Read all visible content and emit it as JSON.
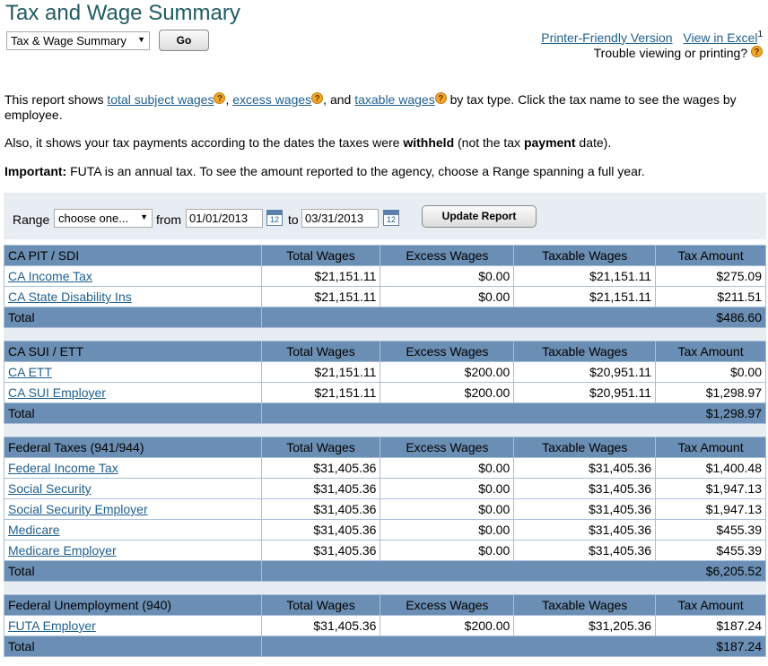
{
  "page": {
    "title": "Tax and Wage Summary",
    "report_select": "Tax & Wage Summary",
    "go_label": "Go",
    "printer_link": "Printer-Friendly Version",
    "excel_link": "View in Excel",
    "superscript": "1",
    "trouble_text": "Trouble viewing or printing?"
  },
  "intro": {
    "p1_a": "This report shows ",
    "link_total": "total subject wages",
    "sep1": ", ",
    "link_excess": "excess wages",
    "sep2": ", and ",
    "link_taxable": "taxable wages",
    "p1_b": " by tax type. Click the tax name to see the wages by employee.",
    "p2_a": "Also, it shows your tax payments according to the dates the taxes were ",
    "p2_bold1": "withheld",
    "p2_b": " (not the tax ",
    "p2_bold2": "payment",
    "p2_c": " date).",
    "p3_bold": "Important:",
    "p3_rest": " FUTA is an annual tax. To see the amount reported to the agency, choose a Range spanning a full year."
  },
  "range": {
    "label": "Range",
    "select": "choose one...",
    "from_label": "from",
    "from": "01/01/2013",
    "to_label": "to",
    "to": "03/31/2013",
    "cal_label": "12",
    "update_label": "Update Report"
  },
  "columns": [
    "Total Wages",
    "Excess Wages",
    "Taxable Wages",
    "Tax Amount"
  ],
  "total_label": "Total",
  "groups": [
    {
      "name": "CA PIT / SDI",
      "rows": [
        {
          "tax": "CA Income Tax",
          "total": "$21,151.11",
          "excess": "$0.00",
          "taxable": "$21,151.11",
          "amount": "$275.09"
        },
        {
          "tax": "CA State Disability Ins",
          "total": "$21,151.11",
          "excess": "$0.00",
          "taxable": "$21,151.11",
          "amount": "$211.51"
        }
      ],
      "total": "$486.60"
    },
    {
      "name": "CA SUI / ETT",
      "rows": [
        {
          "tax": "CA ETT",
          "total": "$21,151.11",
          "excess": "$200.00",
          "taxable": "$20,951.11",
          "amount": "$0.00"
        },
        {
          "tax": "CA SUI Employer",
          "total": "$21,151.11",
          "excess": "$200.00",
          "taxable": "$20,951.11",
          "amount": "$1,298.97"
        }
      ],
      "total": "$1,298.97"
    },
    {
      "name": "Federal Taxes (941/944)",
      "rows": [
        {
          "tax": "Federal Income Tax",
          "total": "$31,405.36",
          "excess": "$0.00",
          "taxable": "$31,405.36",
          "amount": "$1,400.48"
        },
        {
          "tax": "Social Security",
          "total": "$31,405.36",
          "excess": "$0.00",
          "taxable": "$31,405.36",
          "amount": "$1,947.13"
        },
        {
          "tax": "Social Security Employer",
          "total": "$31,405.36",
          "excess": "$0.00",
          "taxable": "$31,405.36",
          "amount": "$1,947.13"
        },
        {
          "tax": "Medicare",
          "total": "$31,405.36",
          "excess": "$0.00",
          "taxable": "$31,405.36",
          "amount": "$455.39"
        },
        {
          "tax": "Medicare Employer",
          "total": "$31,405.36",
          "excess": "$0.00",
          "taxable": "$31,405.36",
          "amount": "$455.39"
        }
      ],
      "total": "$6,205.52"
    },
    {
      "name": "Federal Unemployment (940)",
      "rows": [
        {
          "tax": "FUTA Employer",
          "total": "$31,405.36",
          "excess": "$200.00",
          "taxable": "$31,205.36",
          "amount": "$187.24"
        }
      ],
      "total": "$187.24"
    }
  ]
}
